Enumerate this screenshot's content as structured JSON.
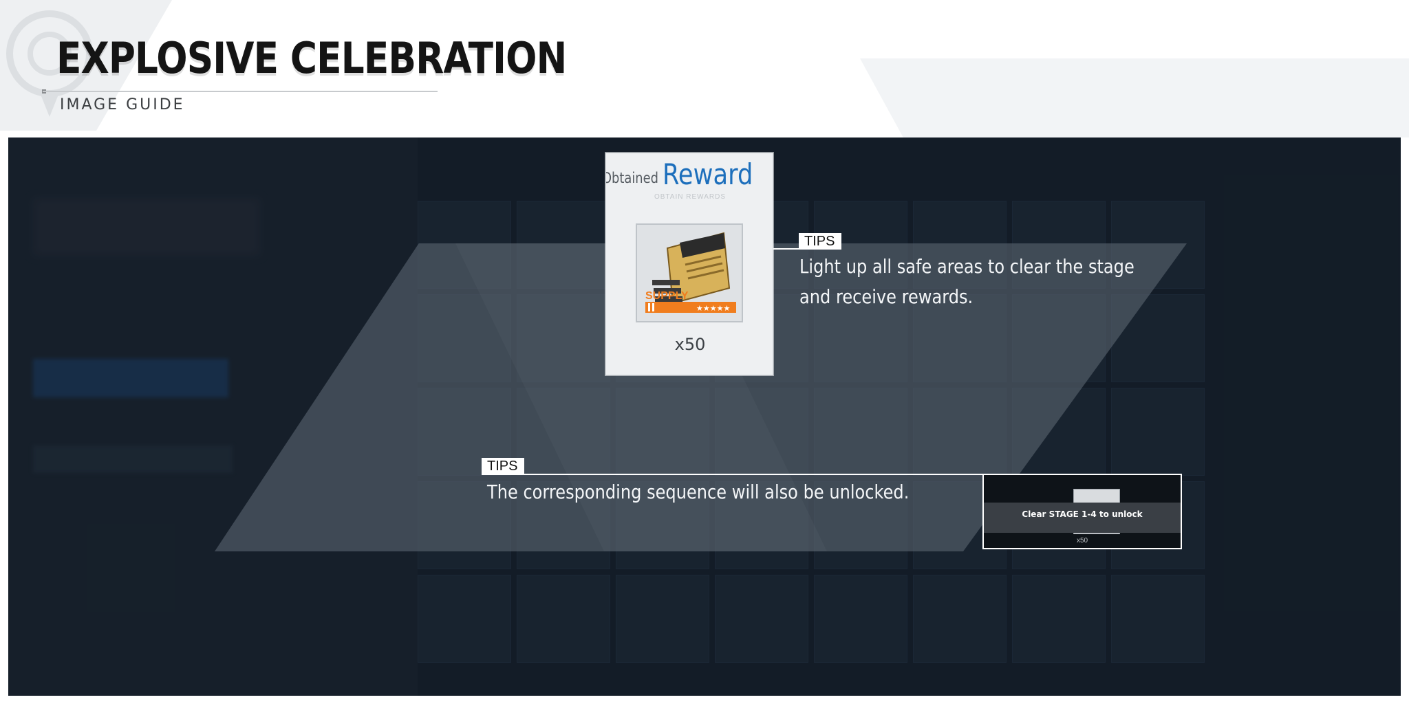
{
  "header": {
    "title": "EXPLOSIVE CELEBRATION",
    "subtitle": "IMAGE GUIDE"
  },
  "reward_card": {
    "obtained_label": "Obtained",
    "reward_label": "Reward",
    "sub_label": "OBTAIN REWARDS",
    "item_icon": "supply-ticket-icon",
    "quantity": "x50"
  },
  "tips": [
    {
      "badge": "TIPS",
      "line1": "Light up all safe areas to clear the stage",
      "line2": "and receive rewards."
    },
    {
      "badge": "TIPS",
      "line1": "The corresponding sequence will also be unlocked."
    }
  ],
  "preview": {
    "label": "Clear STAGE 1-4 to unlock",
    "quantity": "x50"
  },
  "colors": {
    "panel_bg": "#17212b",
    "reward_blue": "#1d6fbc",
    "supply_orange": "#f07d1e"
  }
}
